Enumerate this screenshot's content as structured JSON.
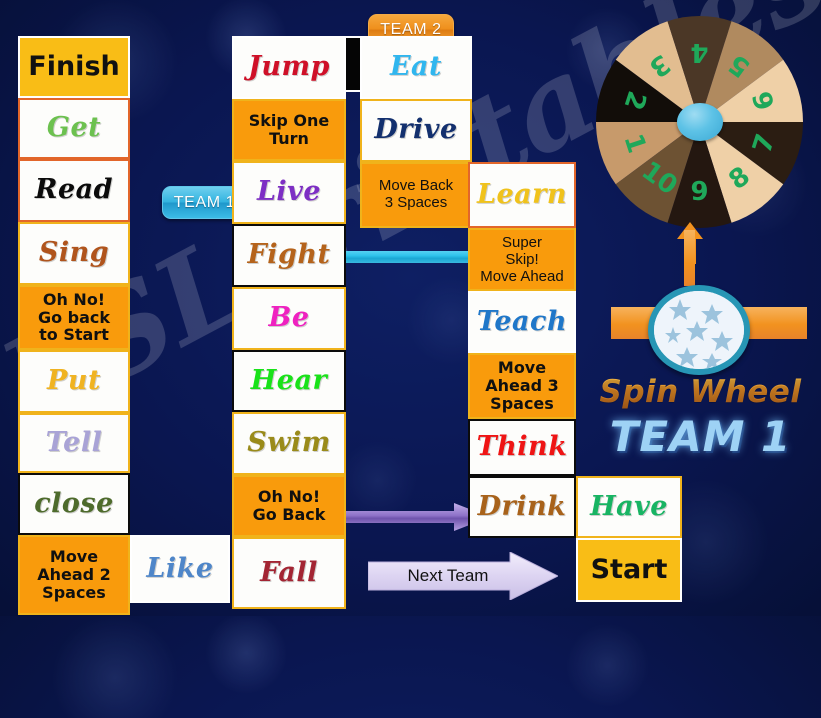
{
  "watermark": "ESLprintables.com",
  "teams": {
    "team1_pill": "TEAM 1",
    "team2_pill": "TEAM 2"
  },
  "spinner": {
    "title": "Spin Wheel",
    "current_team": "TEAM 1",
    "hub_color": "#5dc2e6",
    "pointer_color": "#f2921f",
    "number_color": "#1fa85a",
    "numbers": [
      1,
      2,
      3,
      4,
      5,
      6,
      7,
      8,
      9,
      10
    ],
    "segment_colors": [
      "#c79a6b",
      "#120d09",
      "#e2bd90",
      "#4b3726",
      "#b08a5f",
      "#efd0a7",
      "#2b1d12",
      "#efd0a7",
      "#241710",
      "#6d5233"
    ]
  },
  "controls": {
    "next_team": "Next Team"
  },
  "board": {
    "column_left": [
      {
        "text": "Finish",
        "kind": "end",
        "bg": "#f9bd16",
        "border": "#ffffff",
        "color": "#111111"
      },
      {
        "text": "Get",
        "kind": "word",
        "bg": "#fdfdfb",
        "border": "#e2662a",
        "color": "#6cc14f"
      },
      {
        "text": "Read",
        "kind": "word",
        "bg": "#fdfdfb",
        "border": "#e2662a",
        "color": "#0b0b0b"
      },
      {
        "text": "Sing",
        "kind": "word",
        "bg": "#fdfdfb",
        "border": "#f0b31b",
        "color": "#b0541c"
      },
      {
        "text": "Oh No!\nGo back\nto Start",
        "kind": "instr",
        "bg": "#f99b0c",
        "border": "#f0b31b",
        "color": "#101010"
      },
      {
        "text": "Put",
        "kind": "word",
        "bg": "#fdfdfb",
        "border": "#f0b31b",
        "color": "#f0b321"
      },
      {
        "text": "Tell",
        "kind": "word",
        "bg": "#fdfdfb",
        "border": "#f0b31b",
        "color": "#a9a3d6"
      },
      {
        "text": "close",
        "kind": "word",
        "bg": "#fdfdfb",
        "border": "#0b0b0b",
        "color": "#4e6b2c"
      },
      {
        "text": "Move\nAhead 2\nSpaces",
        "kind": "instr",
        "bg": "#f99b0c",
        "border": "#f0b31b",
        "color": "#101010"
      }
    ],
    "bottom_left_extra": {
      "text": "Like",
      "kind": "word",
      "bg": "#fdfdfb",
      "border": "#ffffff",
      "color": "#4e86c9"
    },
    "column_middle": [
      {
        "text": "Jump",
        "kind": "word",
        "bg": "#fdfdfb",
        "border": "#ffffff",
        "color": "#cf1028"
      },
      {
        "text": "Skip One\nTurn",
        "kind": "instr",
        "bg": "#f99b0c",
        "border": "#f0b31b",
        "color": "#101010"
      },
      {
        "text": "Live",
        "kind": "word",
        "bg": "#fdfdfb",
        "border": "#f0b31b",
        "color": "#7d2ec4"
      },
      {
        "text": "Fight",
        "kind": "word",
        "bg": "#fdfdfb",
        "border": "#0b0b0b",
        "color": "#b5631b"
      },
      {
        "text": "Be",
        "kind": "word",
        "bg": "#fdfdfb",
        "border": "#f0b31b",
        "color": "#ef21c0"
      },
      {
        "text": "Hear",
        "kind": "word",
        "bg": "#fdfdfb",
        "border": "#0b0b0b",
        "color": "#19e219"
      },
      {
        "text": "Swim",
        "kind": "word",
        "bg": "#fdfdfb",
        "border": "#f0b31b",
        "color": "#9a8b1a"
      },
      {
        "text": "Oh No!\nGo Back",
        "kind": "instr",
        "bg": "#f99b0c",
        "border": "#f0b31b",
        "color": "#101010"
      },
      {
        "text": "Fall",
        "kind": "word",
        "bg": "#fdfdfb",
        "border": "#f0b31b",
        "color": "#a32533"
      }
    ],
    "column_right": [
      {
        "text": "Eat",
        "kind": "word",
        "bg": "#fdfdfb",
        "border": "#ffffff",
        "color": "#30b6ee"
      },
      {
        "text": "Drive",
        "kind": "word",
        "bg": "#fdfdfb",
        "border": "#f0b31b",
        "color": "#13306e"
      },
      {
        "text": "Move Back\n3 Spaces",
        "kind": "instr-thin",
        "bg": "#f99b0c",
        "border": "#f0b31b",
        "color": "#101010"
      },
      {
        "text": "Learn",
        "kind": "word",
        "bg": "#fdfdfb",
        "border": "#e2662a",
        "color": "#f0c21b"
      },
      {
        "text": "Super\nSkip!\nMove Ahead",
        "kind": "instr-super",
        "bg": "#f99b0c",
        "border": "#f0b31b",
        "color": "#101010"
      },
      {
        "text": "Teach",
        "kind": "word",
        "bg": "#fdfdfb",
        "border": "#ffffff",
        "color": "#1f77c9"
      },
      {
        "text": "Move\nAhead 3\nSpaces",
        "kind": "instr",
        "bg": "#f99b0c",
        "border": "#f0b31b",
        "color": "#101010"
      },
      {
        "text": "Think",
        "kind": "word",
        "bg": "#fdfdfb",
        "border": "#0b0b0b",
        "color": "#ef1414"
      },
      {
        "text": "Drink",
        "kind": "word",
        "bg": "#fdfdfb",
        "border": "#0b0b0b",
        "color": "#a8621a"
      }
    ],
    "column_far_right": [
      {
        "text": "Have",
        "kind": "word",
        "bg": "#fdfdfb",
        "border": "#f0b31b",
        "color": "#18b463"
      },
      {
        "text": "Start",
        "kind": "end",
        "bg": "#f9bd16",
        "border": "#ffffff",
        "color": "#111111"
      }
    ]
  }
}
